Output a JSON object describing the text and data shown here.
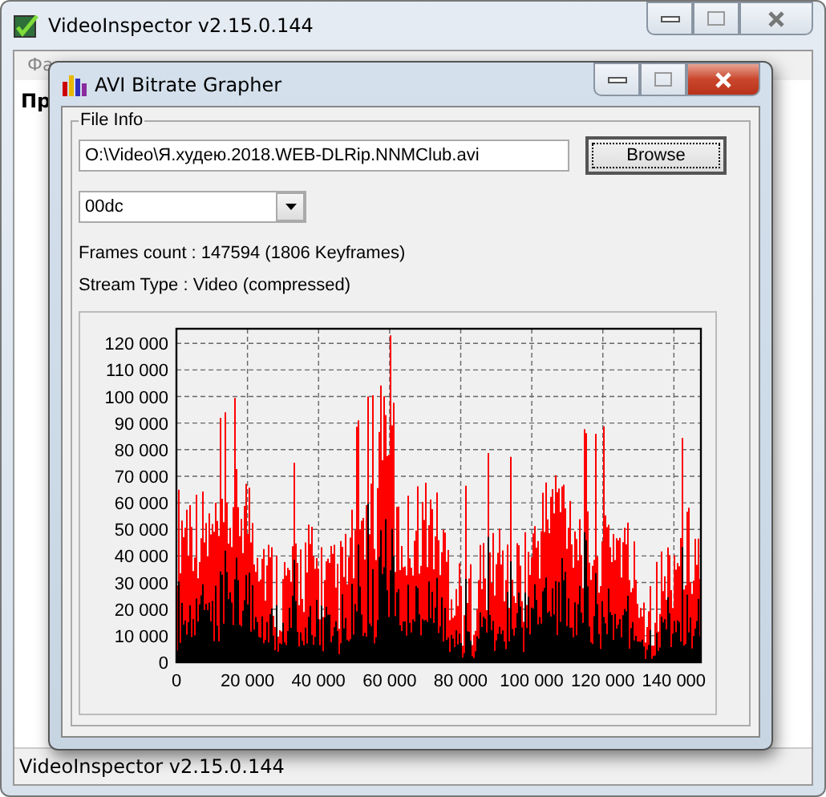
{
  "main_window": {
    "title": "VideoInspector v2.15.0.144",
    "menu_fragment": "Фа",
    "content_fragment": "Пр",
    "status_bar": "VideoInspector v2.15.0.144"
  },
  "dialog": {
    "title": "AVI Bitrate Grapher",
    "group_label": "File Info",
    "file_path": "O:\\Video\\Я.худею.2018.WEB-DLRip.NNMClub.avi",
    "browse_button": "Browse",
    "stream_select": "00dc",
    "frames_count": "Frames count : 147594 (1806 Keyframes)",
    "stream_type": "Stream Type : Video (compressed)",
    "graph": {
      "y_labels": [
        "120 000",
        "110 000",
        "100 000",
        "90 000",
        "80 000",
        "70 000",
        "60 000",
        "50 000",
        "40 000",
        "30 000",
        "20 000",
        "10 000",
        "0"
      ],
      "x_labels": [
        "0",
        "20 000",
        "40 000",
        "60 000",
        "80 000",
        "100 000",
        "120 000",
        "140 000"
      ]
    }
  }
}
